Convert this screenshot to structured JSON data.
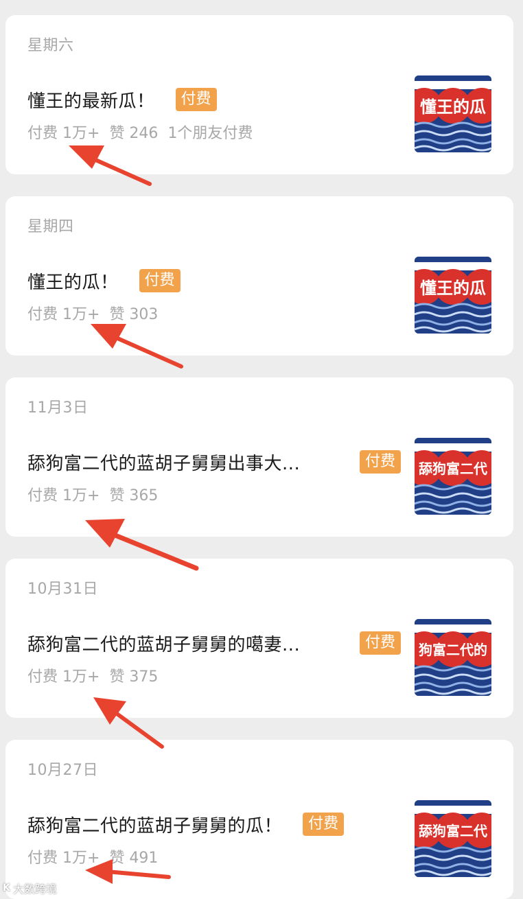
{
  "colors": {
    "badge_bg": "#f2a24a",
    "arrow": "#e8432e",
    "thumb_bg": "#213f86",
    "thumb_circle": "#d9312b"
  },
  "articles": [
    {
      "date": "星期六",
      "title": "懂王的最新瓜！",
      "badge": "付费",
      "paid": "付费 1万+",
      "likes": "赞 246",
      "friends": "1个朋友付费",
      "thumb_text": "懂王的瓜"
    },
    {
      "date": "星期四",
      "title": "懂王的瓜！",
      "badge": "付费",
      "paid": "付费 1万+",
      "likes": "赞 303",
      "thumb_text": "懂王的瓜"
    },
    {
      "date": "11月3日",
      "title": "舔狗富二代的蓝胡子舅舅出事大...",
      "badge": "付费",
      "paid": "付费 1万+",
      "likes": "赞 365",
      "thumb_text": "舔狗富二代"
    },
    {
      "date": "10月31日",
      "title": "舔狗富二代的蓝胡子舅舅的噶妻...",
      "badge": "付费",
      "paid": "付费 1万+",
      "likes": "赞 375",
      "thumb_text": "狗富二代的"
    },
    {
      "date": "10月27日",
      "title": "舔狗富二代的蓝胡子舅舅的瓜！",
      "badge": "付费",
      "paid": "付费 1万+",
      "likes": "赞 491",
      "thumb_text": "舔狗富二代"
    }
  ],
  "watermark": {
    "logo": "K",
    "text": "大数跨境"
  }
}
